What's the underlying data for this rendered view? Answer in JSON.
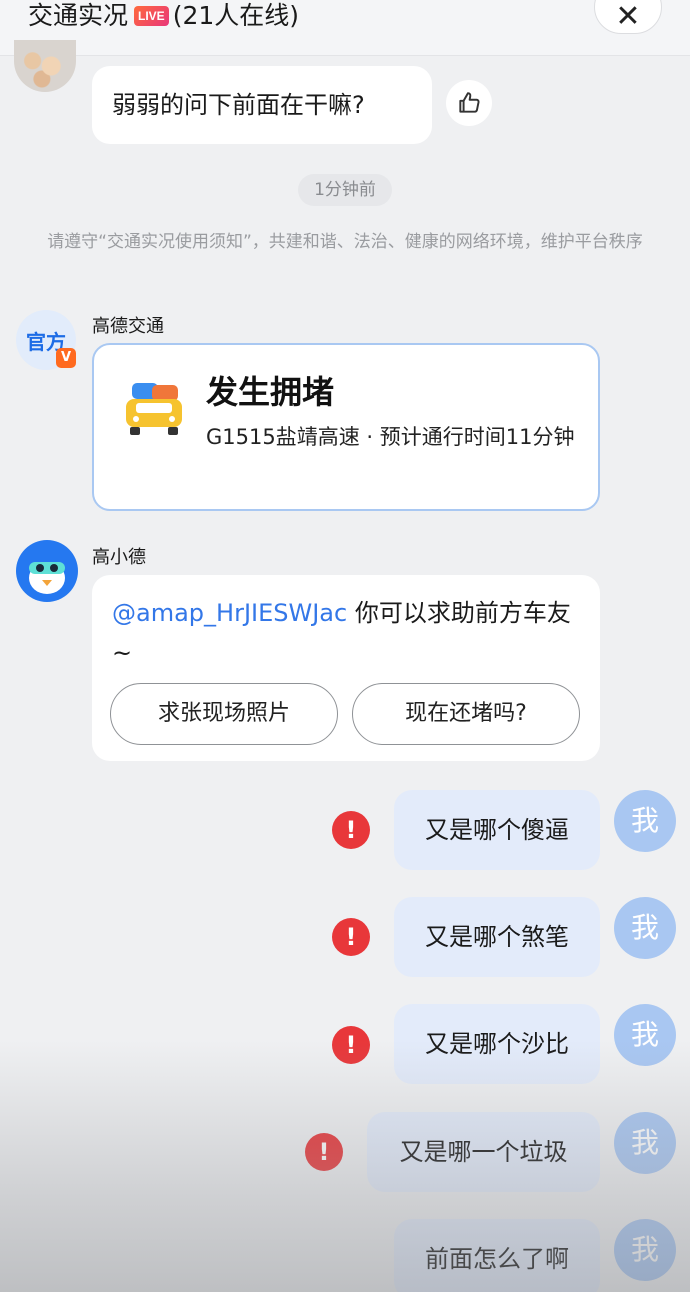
{
  "header": {
    "title": "交通实况",
    "live_badge": "LIVE",
    "online": "(21人在线)",
    "close_icon": "close-icon"
  },
  "messages": {
    "first": {
      "text": "弱弱的问下前面在干嘛?",
      "like_icon": "thumbs-up-icon"
    },
    "time": "1分钟前",
    "notice": "请遵守“交通实况使用须知”，共建和谐、法治、健康的网络环境，维护平台秩序",
    "official": {
      "avatar_text": "官方",
      "badge": "V",
      "sender": "高德交通",
      "card_title": "发生拥堵",
      "card_desc": "G1515盐靖高速 · 预计通行时间11分钟",
      "card_icon": "traffic-jam-icon"
    },
    "bot": {
      "sender": "高小德",
      "mention": "@amap_HrJIESWJac",
      "text": " 你可以求助前方车友~",
      "reply_1": "求张现场照片",
      "reply_2": "现在还堵吗?"
    },
    "mine": [
      {
        "text": "又是哪个傻逼",
        "error": "!",
        "avatar": "我"
      },
      {
        "text": "又是哪个煞笔",
        "error": "!",
        "avatar": "我"
      },
      {
        "text": "又是哪个沙比",
        "error": "!",
        "avatar": "我"
      },
      {
        "text": "又是哪一个垃圾",
        "error": "!",
        "avatar": "我"
      },
      {
        "text": "前面怎么了啊",
        "avatar": "我"
      }
    ]
  },
  "colors": {
    "accent": "#2578f0",
    "error": "#e8373a",
    "my_bubble": "#e3ebfa"
  }
}
